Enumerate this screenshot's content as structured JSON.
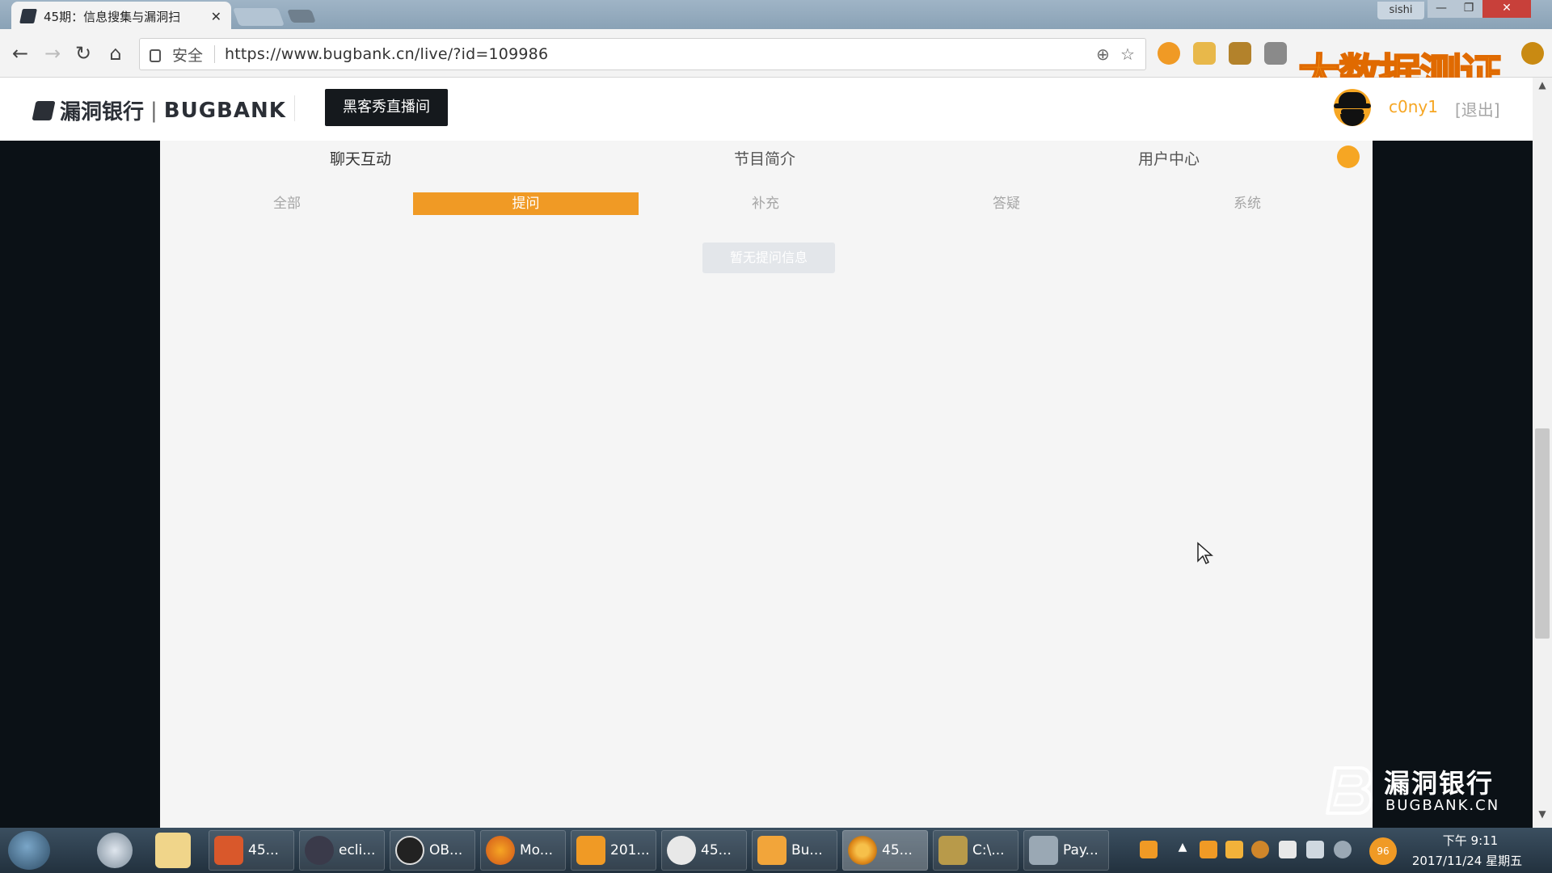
{
  "browser": {
    "tab_title": "45期：信息搜集与漏洞扫",
    "close_glyph": "✕",
    "window_user": "sishi",
    "minimize_glyph": "—",
    "maximize_glyph": "❐",
    "close_window_glyph": "✕",
    "back_glyph": "←",
    "forward_glyph": "→",
    "reload_glyph": "↻",
    "home_glyph": "⌂",
    "secure_label": "安全",
    "url": "https://www.bugbank.cn/live/?id=109986",
    "zoom_glyph": "⊕",
    "star_glyph": "☆",
    "overlay_watermark": "大数据测证"
  },
  "site": {
    "logo_cn": "漏洞银行",
    "logo_sep": "|",
    "logo_en": "BUGBANK",
    "live_button": "黑客秀直播间",
    "username": "c0ny1",
    "logout": "[退出]"
  },
  "panel": {
    "tabs": [
      "聊天互动",
      "节目简介",
      "用户中心"
    ],
    "filters": [
      "全部",
      "提问",
      "补充",
      "答疑",
      "系统"
    ],
    "active_filter_index": 1,
    "empty_message": "暂无提问信息"
  },
  "watermark": {
    "cn": "漏洞银行",
    "en": "BUGBANK.CN"
  },
  "taskbar": {
    "items": [
      {
        "label": "45...",
        "icon": "powerpoint-icon"
      },
      {
        "label": "ecli...",
        "icon": "eclipse-icon"
      },
      {
        "label": "OB...",
        "icon": "obs-icon"
      },
      {
        "label": "Mo...",
        "icon": "firefox-icon"
      },
      {
        "label": "201...",
        "icon": "player-icon"
      },
      {
        "label": "45...",
        "icon": "people-icon"
      },
      {
        "label": "Bu...",
        "icon": "burp-icon"
      },
      {
        "label": "45...",
        "icon": "chrome-icon"
      },
      {
        "label": "C:\\...",
        "icon": "folder-icon"
      },
      {
        "label": "Pay...",
        "icon": "payload-icon"
      }
    ],
    "active_index": 7,
    "tray_badge": "96",
    "clock_time": "下午 9:11",
    "clock_date": "2017/11/24 星期五"
  },
  "colors": {
    "accent": "#f09a25",
    "username": "#f6a623",
    "live_button_bg": "#15191d",
    "panel_bg": "#f5f5f5"
  }
}
